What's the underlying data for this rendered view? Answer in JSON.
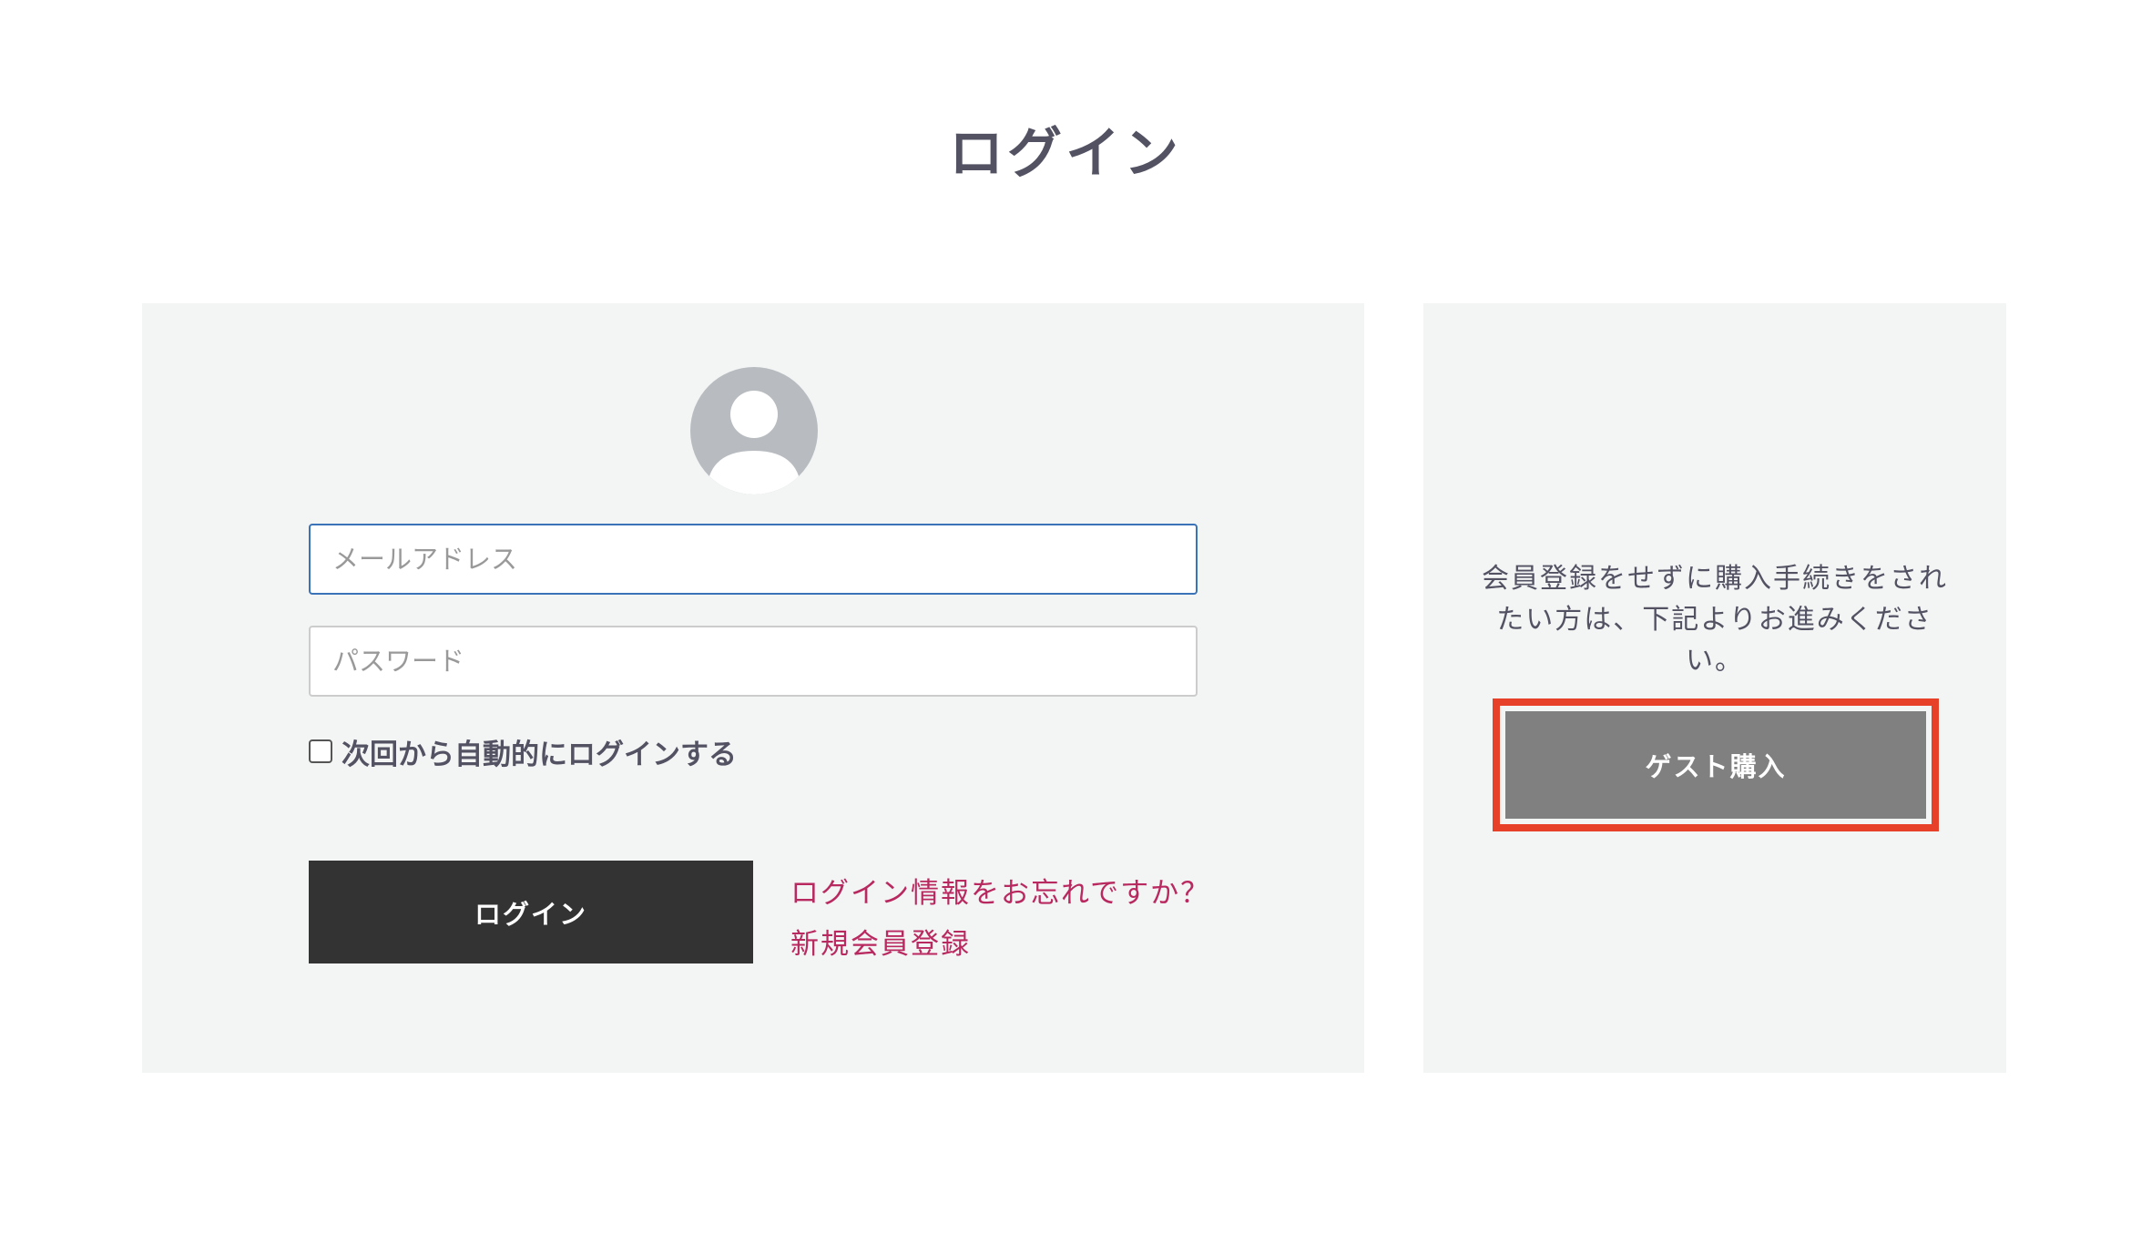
{
  "page": {
    "title": "ログイン"
  },
  "login": {
    "avatar_icon": "user-avatar-icon",
    "email_placeholder": "メールアドレス",
    "password_placeholder": "パスワード",
    "remember_label": "次回から自動的にログインする",
    "remember_checked": false,
    "submit_label": "ログイン",
    "forgot_link": "ログイン情報をお忘れですか？",
    "register_link": "新規会員登録"
  },
  "guest": {
    "description": "会員登録をせずに購入手続きをされたい方は、下記よりお進みください。",
    "button_label": "ゲスト購入",
    "highlight_color": "#e8412a"
  },
  "colors": {
    "panel_bg": "#f3f4f4",
    "text": "#525263",
    "link": "#b8295f",
    "login_button": "#333333",
    "guest_button": "#808080"
  }
}
